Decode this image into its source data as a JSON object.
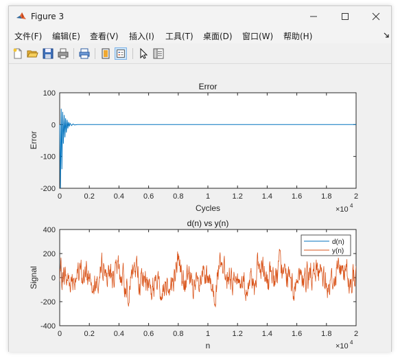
{
  "window": {
    "title": "Figure 3"
  },
  "menu": [
    "文件(F)",
    "编辑(E)",
    "查看(V)",
    "插入(I)",
    "工具(T)",
    "桌面(D)",
    "窗口(W)",
    "帮助(H)"
  ],
  "menu_overflow_icon": "arrow-icon",
  "toolbar": [
    "new-figure-icon",
    "open-file-icon",
    "save-icon",
    "print-icon",
    "print-preview-icon",
    "link-plot-icon",
    "insert-legend-icon",
    "edit-plot-arrow-icon",
    "property-inspector-icon"
  ],
  "colors": {
    "series_blue": "#0072BD",
    "series_orange": "#D95319"
  },
  "chart_data": [
    {
      "type": "line",
      "title": "Error",
      "xlabel": "Cycles",
      "ylabel": "Error",
      "xlim": [
        0,
        20000
      ],
      "ylim": [
        -200,
        100
      ],
      "x_exponent": "×10^4",
      "x_ticks": [
        "0",
        "0.2",
        "0.4",
        "0.6",
        "0.8",
        "1",
        "1.2",
        "1.4",
        "1.6",
        "1.8",
        "2"
      ],
      "y_ticks": [
        "100",
        "0",
        "-100",
        "-200"
      ],
      "series": [
        {
          "color": "#0072BD",
          "description": "large oscillation at start decaying to ~0 by ~1000 cycles, then flat at 0",
          "x": [
            0,
            50,
            100,
            150,
            200,
            250,
            300,
            350,
            400,
            450,
            500,
            550,
            600,
            650,
            700,
            800,
            900,
            1000,
            1200,
            20000
          ],
          "y": [
            0,
            -200,
            50,
            -140,
            40,
            -60,
            30,
            -40,
            20,
            -25,
            15,
            -12,
            8,
            -6,
            4,
            -3,
            2,
            -1,
            0,
            0
          ]
        }
      ]
    },
    {
      "type": "line",
      "title": "d(n) vs y(n)",
      "xlabel": "n",
      "ylabel": "Signal",
      "xlim": [
        0,
        20000
      ],
      "ylim": [
        -400,
        400
      ],
      "x_exponent": "×10^4",
      "x_ticks": [
        "0",
        "0.2",
        "0.4",
        "0.6",
        "0.8",
        "1",
        "1.2",
        "1.4",
        "1.6",
        "1.8",
        "2"
      ],
      "y_ticks": [
        "400",
        "200",
        "0",
        "-200",
        "-400"
      ],
      "legend": {
        "position": "top-right",
        "entries": [
          "d(n)",
          "y(n)"
        ]
      },
      "series": [
        {
          "name": "d(n)",
          "color": "#0072BD",
          "amplitude_range": [
            -350,
            330
          ]
        },
        {
          "name": "y(n)",
          "color": "#D95319",
          "amplitude_range": [
            -350,
            330
          ]
        }
      ]
    }
  ]
}
